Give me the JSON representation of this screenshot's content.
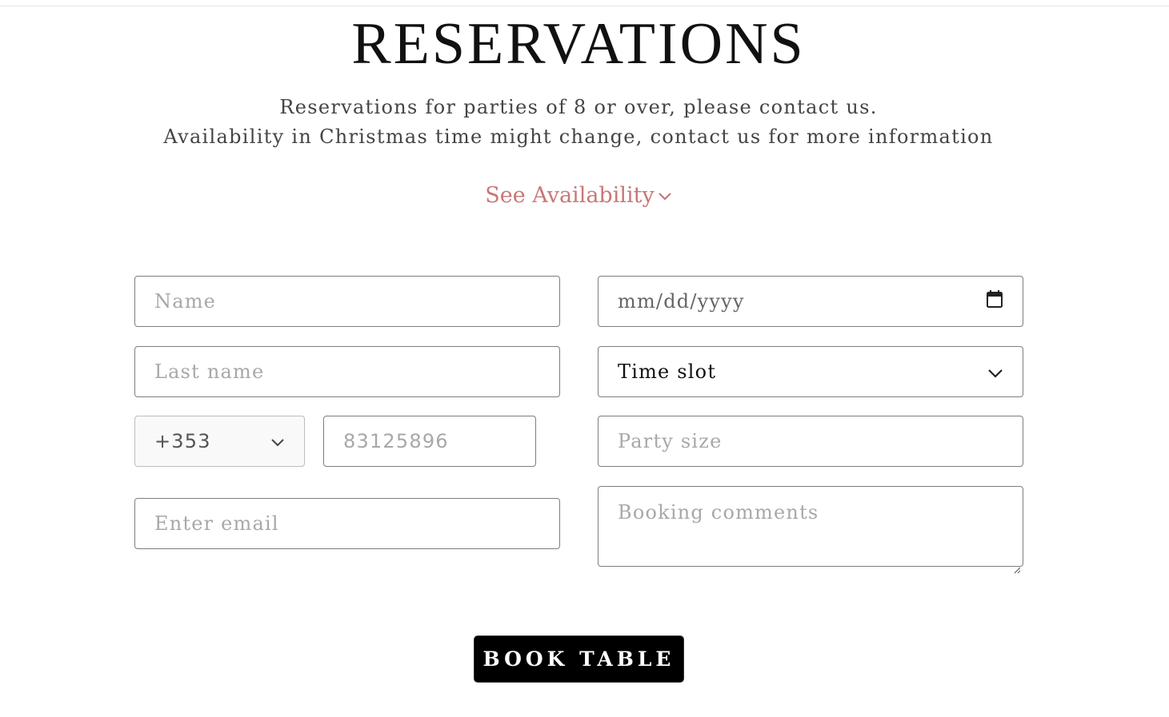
{
  "header": {
    "title": "RESERVATIONS",
    "intro_line1": "Reservations for parties of 8 or over, please contact us.",
    "intro_line2": "Availability in Christmas time might change, contact us for more information"
  },
  "availability_link": {
    "label": "See Availability",
    "icon": "chevron-down-icon",
    "color": "#c97777"
  },
  "form": {
    "name_placeholder": "Name",
    "last_name_placeholder": "Last name",
    "phone_code_value": "+353",
    "phone_placeholder": "83125896",
    "email_placeholder": "Enter email",
    "date_placeholder": "mm/dd/yyyy",
    "date_icon": "calendar-icon",
    "time_slot_value": "Time slot",
    "party_size_placeholder": "Party size",
    "comments_placeholder": "Booking comments"
  },
  "submit": {
    "label": "BOOK TABLE",
    "background": "#000000"
  }
}
